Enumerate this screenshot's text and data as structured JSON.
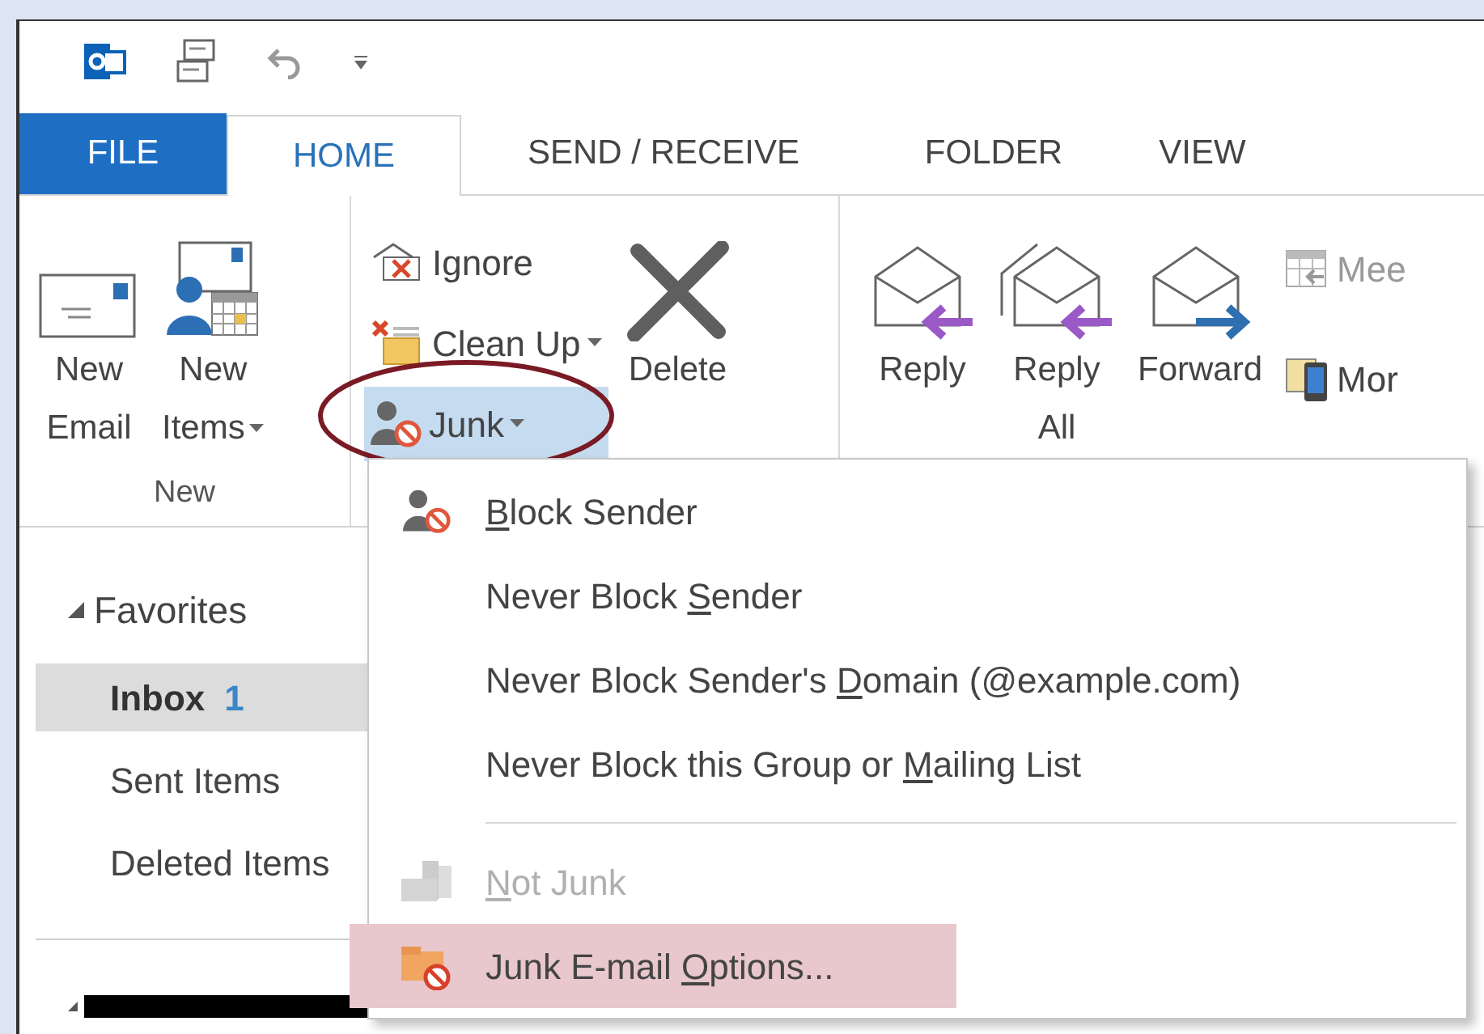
{
  "tabs": [
    {
      "label": "FILE",
      "kind": "file",
      "selected": false
    },
    {
      "label": "HOME",
      "kind": "tab",
      "selected": true
    },
    {
      "label": "SEND / RECEIVE",
      "kind": "tab",
      "selected": false
    },
    {
      "label": "FOLDER",
      "kind": "tab",
      "selected": false
    },
    {
      "label": "VIEW",
      "kind": "tab",
      "selected": false
    }
  ],
  "ribbon": {
    "groups": [
      {
        "label": "New",
        "buttons": [
          {
            "kind": "new_email",
            "lines": [
              "New",
              "Email"
            ],
            "dropdown": false
          },
          {
            "kind": "new_items",
            "lines": [
              "New",
              "Items"
            ],
            "dropdown": true
          }
        ]
      },
      {
        "small_buttons": [
          {
            "kind": "ignore",
            "label": "Ignore",
            "dropdown": false,
            "selected": false
          },
          {
            "kind": "clean_up",
            "label": "Clean Up",
            "dropdown": true,
            "selected": false
          },
          {
            "kind": "junk",
            "label": "Junk",
            "dropdown": true,
            "selected": true
          }
        ],
        "buttons": [
          {
            "kind": "delete",
            "lines": [
              "Delete"
            ],
            "dropdown": false
          }
        ]
      },
      {
        "buttons": [
          {
            "kind": "reply",
            "lines": [
              "Reply"
            ],
            "dropdown": false
          },
          {
            "kind": "reply_all",
            "lines": [
              "Reply",
              "All"
            ],
            "dropdown": false
          },
          {
            "kind": "forward",
            "lines": [
              "Forward"
            ],
            "dropdown": false
          }
        ],
        "small_buttons": [
          {
            "kind": "meeting",
            "label": "Mee",
            "dropdown": false,
            "selected": false
          },
          {
            "kind": "more",
            "label": "Mor",
            "dropdown": false,
            "selected": false
          }
        ]
      }
    ]
  },
  "sidebar": {
    "header": {
      "label": "Favorites",
      "expanded": true
    },
    "items": [
      {
        "label": "Inbox",
        "count": "1",
        "selected": true
      },
      {
        "label": "Sent Items",
        "selected": false
      },
      {
        "label": "Deleted Items",
        "selected": false
      }
    ]
  },
  "junk_menu": {
    "items": [
      {
        "kind": "block",
        "key": "B",
        "after": "lock Sender",
        "disabled": false,
        "selected": false
      },
      {
        "kind": "plain",
        "before": "Never Block ",
        "key": "S",
        "after": "ender",
        "disabled": false,
        "selected": false
      },
      {
        "kind": "plain",
        "before": "Never Block Sender's ",
        "key": "D",
        "after": "omain (@example.com)",
        "disabled": false,
        "selected": false
      },
      {
        "kind": "plain",
        "before": "Never Block this Group or ",
        "key": "M",
        "after": "ailing List",
        "disabled": false,
        "selected": false
      },
      {
        "kind": "separator"
      },
      {
        "kind": "not_junk",
        "key": "N",
        "after": "ot Junk",
        "disabled": true,
        "selected": false
      },
      {
        "kind": "options",
        "before": "Junk E-mail ",
        "key": "O",
        "after": "ptions...",
        "disabled": false,
        "selected": true
      }
    ]
  }
}
